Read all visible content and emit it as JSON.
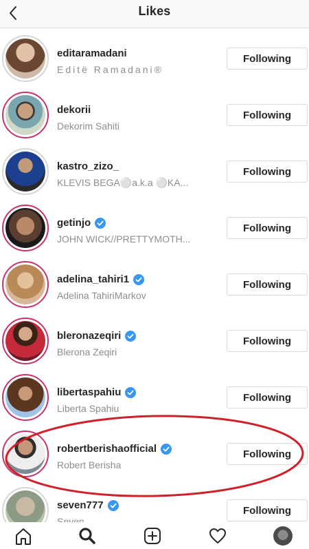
{
  "header": {
    "title": "Likes",
    "back_icon": "chevron-left-icon"
  },
  "follow_label": "Following",
  "users": [
    {
      "username": "editaramadani",
      "fullname": "Editë Ramadani®",
      "verified": false,
      "avatar": "woman-long-hair",
      "story_ring": false
    },
    {
      "username": "dekorii",
      "fullname": "Dekorim Sahiti",
      "verified": false,
      "avatar": "man-sunglasses",
      "story_ring": true
    },
    {
      "username": "kastro_zizo_",
      "fullname": "KLEVIS BEGA⚪a.k.a ⚪KA...",
      "verified": false,
      "avatar": "man-suit-blue",
      "story_ring": false
    },
    {
      "username": "getinjo",
      "fullname": "JOHN WICK//PRETTYMOTH...",
      "verified": true,
      "avatar": "shirtless-man",
      "story_ring": true
    },
    {
      "username": "adelina_tahiri1",
      "fullname": "Adelina TahiriMarkov",
      "verified": true,
      "avatar": "woman-blonde",
      "story_ring": true
    },
    {
      "username": "bleronazeqiri",
      "fullname": "Blerona Zeqiri",
      "verified": true,
      "avatar": "woman-red-dress",
      "story_ring": true
    },
    {
      "username": "libertaspahiu",
      "fullname": "Liberta Spahiu",
      "verified": true,
      "avatar": "woman-curly-hair",
      "story_ring": true
    },
    {
      "username": "robertberishaofficial",
      "fullname": "Robert Berisha",
      "verified": true,
      "avatar": "man-white-shirt",
      "story_ring": true
    },
    {
      "username": "seven777",
      "fullname": "Seven",
      "verified": true,
      "avatar": "man-bald",
      "story_ring": false
    }
  ],
  "annotation": {
    "shape": "red-ellipse",
    "color": "#d0202a",
    "highlights": "robertberishaofficial"
  },
  "tabbar": {
    "tabs": [
      "home-icon",
      "search-icon",
      "add-post-icon",
      "heart-icon",
      "profile-avatar"
    ],
    "active": "search-icon"
  },
  "colors": {
    "verified_blue": "#3897f0",
    "story_ring": "#c8326c",
    "secondary_text": "#8e8e8e"
  }
}
